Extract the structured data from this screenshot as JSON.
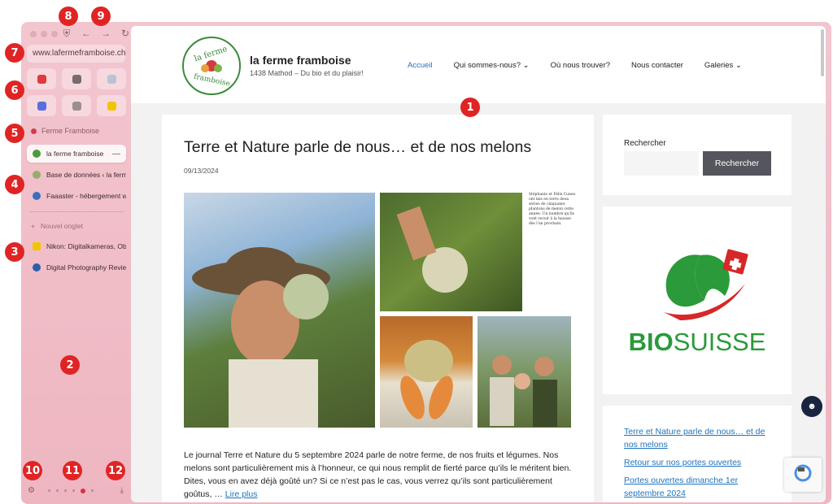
{
  "browser": {
    "url": "www.lafermeframboise.ch",
    "nav_icons": [
      "shield-icon",
      "back-icon",
      "forward-icon",
      "reload-icon"
    ],
    "favorites": [
      {
        "name": "youtube",
        "color": "#e03a3a"
      },
      {
        "name": "app-grey",
        "color": "#7a6a6e"
      },
      {
        "name": "app-doc",
        "color": "#b8c3d6"
      },
      {
        "name": "app-blue",
        "color": "#5b6ee0"
      },
      {
        "name": "app-f",
        "color": "#9a8f8f"
      },
      {
        "name": "nikon",
        "color": "#f2c400"
      }
    ],
    "folder": "Ferme Framboise",
    "tabs": [
      {
        "label": "la ferme framboise",
        "active": true,
        "color": "#4b9a3c"
      },
      {
        "label": "Base de données ‹ la ferme",
        "active": false,
        "color": "#9aaa6a"
      },
      {
        "label": "Faaaster - hébergement web",
        "active": false,
        "color": "#3a6ec0"
      }
    ],
    "new_tab": "Nouvel onglet",
    "pinned": [
      {
        "label": "Nikon: Digitalkameras, Objektive",
        "color": "#f2c400"
      },
      {
        "label": "Digital Photography Review",
        "color": "#2d5fa8"
      }
    ]
  },
  "site": {
    "logo_text": "la ferme framboise",
    "title": "la ferme framboise",
    "description": "1438 Mathod – Du bio et du plaisir!",
    "menu": [
      {
        "label": "Accueil",
        "current": true,
        "dropdown": false
      },
      {
        "label": "Qui sommes-nous?",
        "current": false,
        "dropdown": true
      },
      {
        "label": "Où nous trouver?",
        "current": false,
        "dropdown": false
      },
      {
        "label": "Nous contacter",
        "current": false,
        "dropdown": false
      },
      {
        "label": "Galeries",
        "current": false,
        "dropdown": true
      }
    ]
  },
  "article": {
    "title": "Terre et Nature parle de nous… et de nos melons",
    "date": "09/13/2024",
    "caption": "Stéphanie et Félix Cuneo ont mis en terre deux séries de cinquante plantons de melon cette année. Un nombre qu'ils vont revoir à la hausse dès l'an prochain.",
    "text": "Le journal Terre et Nature du 5 septembre 2024 parle de notre ferme, de nos fruits et légumes. Nos melons sont particulièrement mis à l’honneur, ce qui nous remplit de fierté parce qu’ils le méritent bien. Dites, vous en avez déjà goûté un? Si ce n’est pas le cas, vous verrez qu’ils sont particulièrement goûtus, …",
    "read_more": "Lire plus"
  },
  "sidebar": {
    "search_label": "Rechercher",
    "search_button": "Rechercher",
    "logo_text": "BIOSUISSE",
    "recent": [
      "Terre et Nature parle de nous… et de nos melons",
      "Retour sur nos portes ouvertes",
      "Portes ouvertes dimanche 1er septembre 2024"
    ]
  },
  "markers": [
    "1",
    "2",
    "3",
    "4",
    "5",
    "6",
    "7",
    "8",
    "9",
    "10",
    "11",
    "12"
  ],
  "colors": {
    "link": "#1e73be",
    "marker": "#e02424",
    "sidebar_bg": "#f2c0ca"
  }
}
